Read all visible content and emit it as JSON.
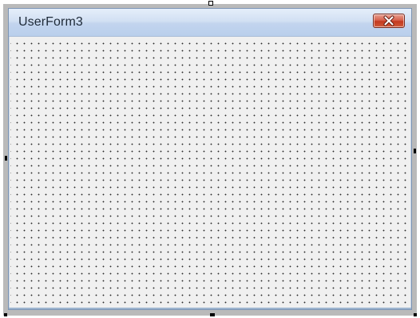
{
  "window": {
    "title": "UserForm3"
  },
  "icons": {
    "close": "close-icon"
  },
  "colors": {
    "title_bar": "#c9d8ef",
    "close_button": "#c9452b",
    "grid_dot": "#2b2b2b",
    "surface": "#f0f0f0"
  }
}
